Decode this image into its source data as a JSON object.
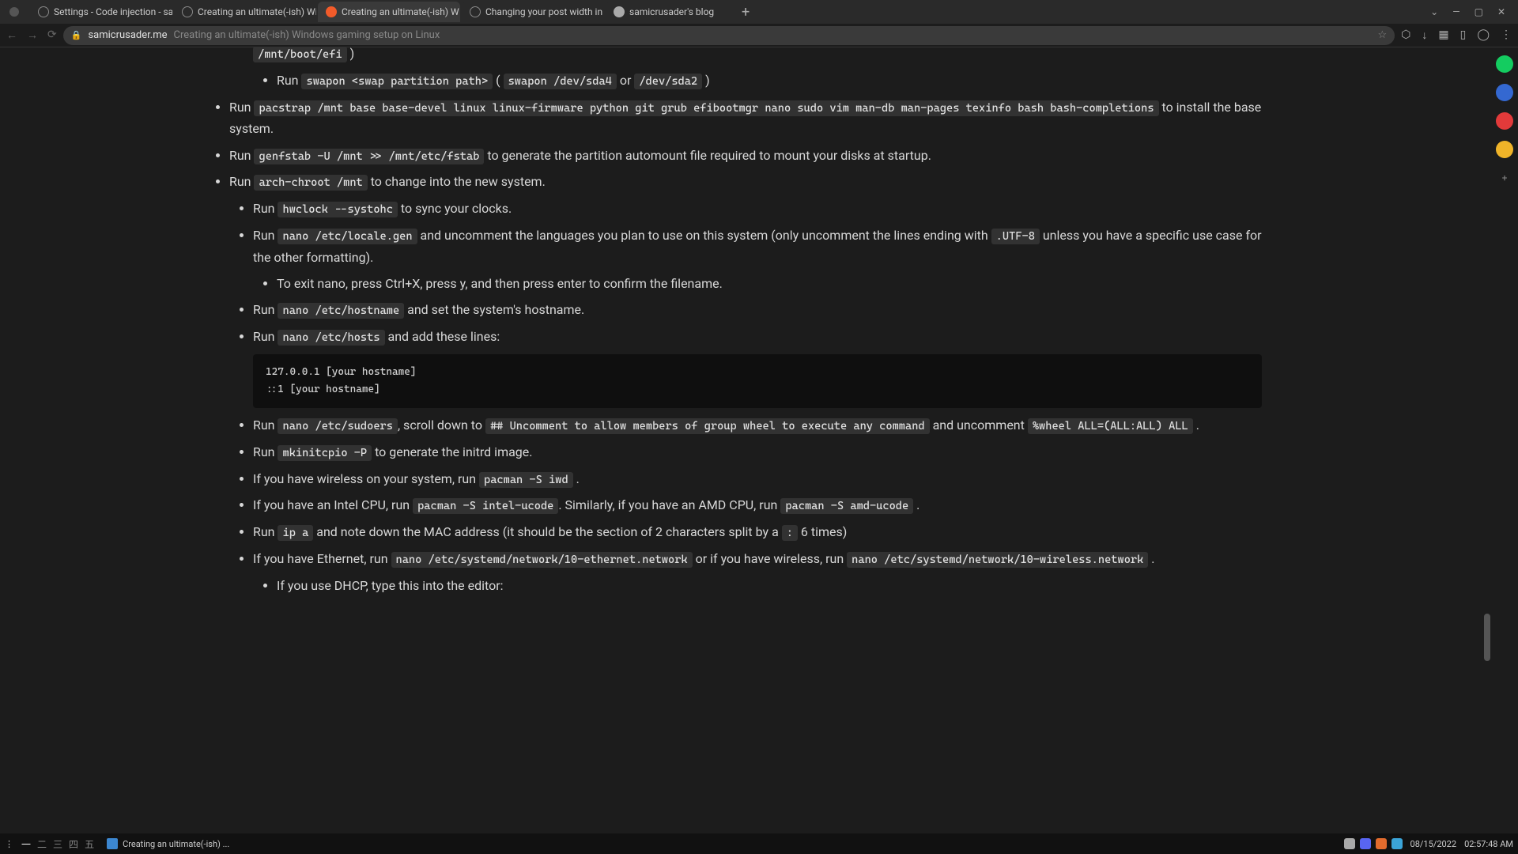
{
  "window": {
    "minimize_icon": "—",
    "maximize_icon": "▢",
    "close_icon": "✕",
    "dropdown_icon": "⌄"
  },
  "tabs": [
    {
      "label": "Settings - Code injection - sa"
    },
    {
      "label": "Creating an ultimate(-ish) Wi"
    },
    {
      "label": "Creating an ultimate(-ish) W",
      "active": true
    },
    {
      "label": "Changing your post width in"
    },
    {
      "label": "samicrusader's blog"
    }
  ],
  "new_tab": "+",
  "addressbar": {
    "back_icon": "←",
    "forward_icon": "→",
    "reload_icon": "⟳",
    "lock_icon": "🔒",
    "url_host": "samicrusader.me",
    "url_title": "Creating an ultimate(-ish) Windows gaming setup on Linux",
    "star_icon": "☆"
  },
  "toolbar": {
    "shield_icon": "⬡",
    "download_icon": "↓",
    "qr_icon": "▦",
    "sidepanel_icon": "▯",
    "profile_icon": "◯",
    "menu_icon": "⋮"
  },
  "sidebar": {
    "add_icon": "+"
  },
  "article": {
    "code_mnt_efi": "/mnt/boot/efi",
    "close_paren": " )",
    "li_run_swapon": "Run ",
    "code_swapon": "swapon <swap partition path>",
    "paren_open": " ( ",
    "code_swapon_sda4": "swapon /dev/sda4",
    "or_txt": " or ",
    "code_dev_sda2": "/dev/sda2",
    "li_run_pacstrap": "Run ",
    "code_pacstrap": "pacstrap /mnt base base-devel linux linux-firmware python git grub efibootmgr nano sudo vim man-db man-pages texinfo bash bash-completions",
    "pacstrap_after": " to install the base system.",
    "li_run_genfstab": "Run ",
    "code_genfstab": "genfstab -U /mnt >> /mnt/etc/fstab",
    "genfstab_after": " to generate the partition automount file required to mount your disks at startup.",
    "li_run_chroot": "Run ",
    "code_chroot": "arch-chroot /mnt",
    "chroot_after": " to change into the new system.",
    "li_run_hwclock": "Run ",
    "code_hwclock": "hwclock --systohc",
    "hwclock_after": " to sync your clocks.",
    "li_run_locale": "Run ",
    "code_locale": "nano /etc/locale.gen",
    "locale_after1": " and uncomment the languages you plan to use on this system (only uncomment the lines ending with ",
    "code_utf8": ".UTF-8",
    "locale_after2": " unless you have a specific use case for the other formatting).",
    "li_exit_nano": "To exit nano, press Ctrl+X, press y, and then press enter to confirm the filename.",
    "li_run_hostname": "Run ",
    "code_hostname": "nano /etc/hostname",
    "hostname_after": " and set the system's hostname.",
    "li_run_hosts": "Run ",
    "code_hosts": "nano /etc/hosts",
    "hosts_after": " and add these lines:",
    "pre_hosts": "127.0.0.1 [your hostname]\n::1 [your hostname]",
    "li_run_sudoers": "Run ",
    "code_sudoers": "nano /etc/sudoers",
    "sudoers_after1": ", scroll down to ",
    "code_sudoers_comment": "## Uncomment to allow members of group wheel to execute any command",
    "sudoers_after2": " and uncomment ",
    "code_wheel": "%wheel ALL=(ALL:ALL) ALL",
    "period": " .",
    "li_run_mkinitcpio": "Run ",
    "code_mkinitcpio": "mkinitcpio -P",
    "mkinitcpio_after": " to generate the initrd image.",
    "li_wireless": "If you have wireless on your system, run ",
    "code_iwd": "pacman -S iwd",
    "li_intel": "If you have an Intel CPU, run ",
    "code_intel": "pacman -S intel-ucode",
    "intel_after": ". Similarly, if you have an AMD CPU, run ",
    "code_amd": "pacman -S amd-ucode",
    "li_ipa": "Run ",
    "code_ipa": "ip a",
    "ipa_after1": " and note down the MAC address (it should be the section of 2 characters split by a ",
    "code_colon": ":",
    "ipa_after2": " 6 times)",
    "li_ethernet": "If you have Ethernet, run ",
    "code_eth": "nano /etc/systemd/network/10-ethernet.network",
    "eth_after": " or if you have wireless, run ",
    "code_wifi": "nano /etc/systemd/network/10-wireless.network",
    "li_dhcp": "If you use DHCP, type this into the editor:"
  },
  "taskbar": {
    "tiling_icon": "⋮",
    "workspaces": [
      "一",
      "二",
      "三",
      "四",
      "五"
    ],
    "app_label": "Creating an ultimate(-ish) ...",
    "clock": "02:57:48 AM",
    "date": "08/15/2022"
  }
}
